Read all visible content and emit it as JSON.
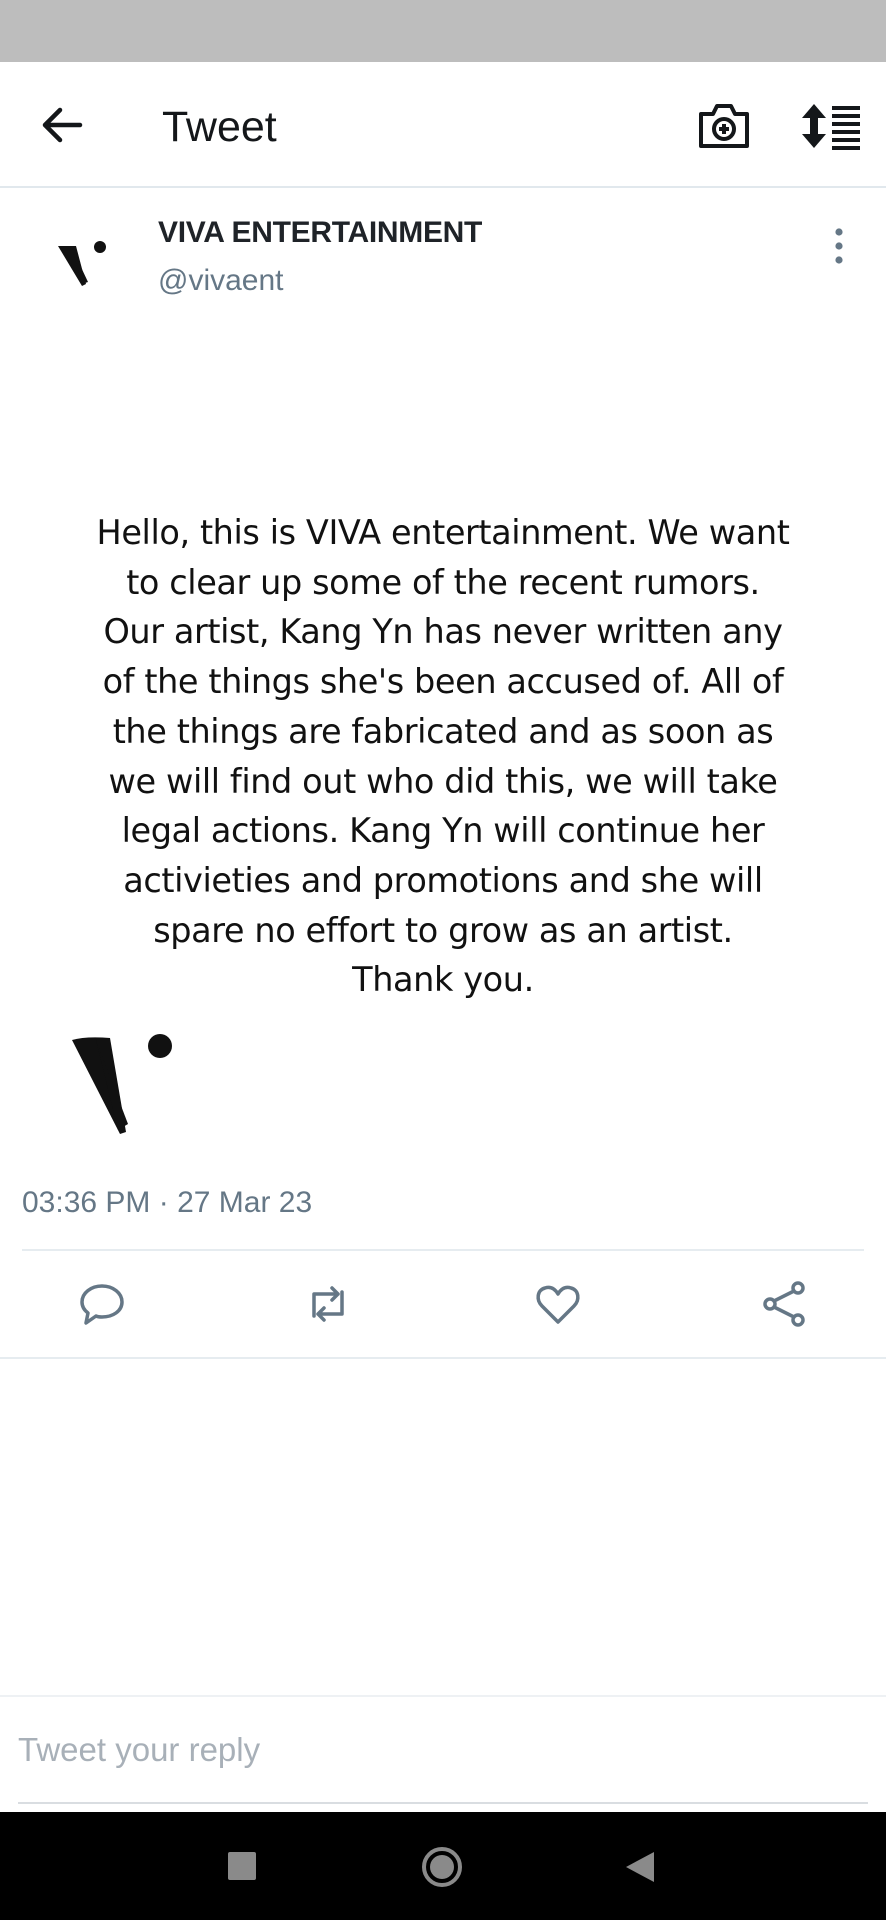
{
  "app_bar": {
    "title": "Tweet",
    "icons": {
      "back": "arrow-left-icon",
      "camera": "camera-add-icon",
      "sort": "sort-list-icon"
    }
  },
  "tweet": {
    "author": {
      "name": "VIVA ENTERTAINMENT",
      "handle": "@vivaent",
      "avatar_icon": "viva-logo-icon"
    },
    "statement_lines": [
      "Hello, this is VIVA entertainment. We want",
      "to clear up some of the recent rumors.",
      "Our artist, Kang Yn has never written any",
      "of the things she's been accused of. All of",
      "the things are fabricated and as soon as",
      "we will find out who did this, we will take",
      "legal actions. Kang Yn will continue her",
      "activieties and promotions and she will",
      "spare no effort to grow as an artist.",
      "Thank you."
    ],
    "timestamp": "03:36 PM · 27 Mar 23",
    "actions": [
      "reply-icon",
      "retweet-icon",
      "like-icon",
      "share-icon"
    ]
  },
  "reply": {
    "placeholder": "Tweet your reply"
  },
  "system_nav": {
    "buttons": [
      "recents-icon",
      "home-icon",
      "back-triangle-icon"
    ]
  },
  "colors": {
    "status_bar": "#bdbdbd",
    "secondary_text": "#657786",
    "nav_bar": "#000000",
    "icon": "#657786"
  }
}
